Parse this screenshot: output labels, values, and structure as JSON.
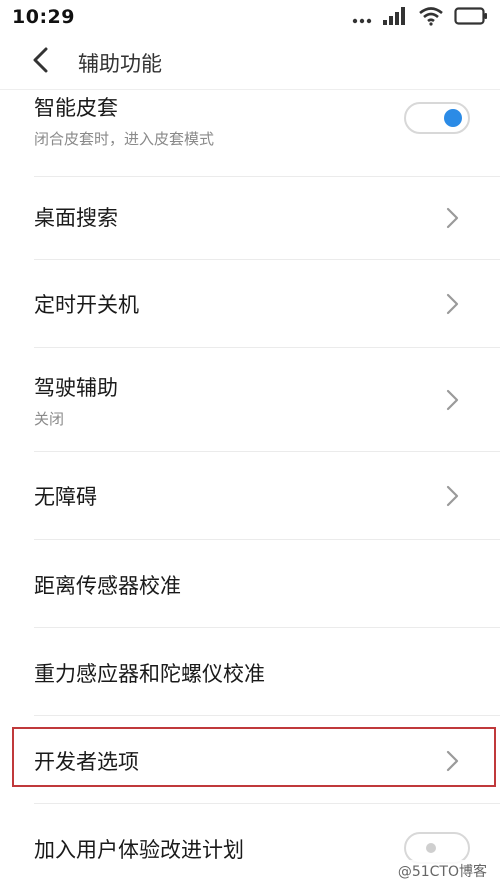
{
  "status_bar": {
    "time": "10:29",
    "icons": [
      "more-dots-icon",
      "signal-icon",
      "wifi-icon",
      "battery-icon"
    ]
  },
  "header": {
    "title": "辅助功能",
    "back_icon": "back-arrow-icon"
  },
  "settings": [
    {
      "id": "smart-cover",
      "title": "智能皮套",
      "subtitle": "闭合皮套时，进入皮套模式",
      "control": "toggle",
      "toggle_on": true
    },
    {
      "id": "desktop-search",
      "title": "桌面搜索",
      "control": "chevron"
    },
    {
      "id": "scheduled-power",
      "title": "定时开关机",
      "control": "chevron"
    },
    {
      "id": "driving-assist",
      "title": "驾驶辅助",
      "subtitle": "关闭",
      "control": "chevron"
    },
    {
      "id": "accessibility",
      "title": "无障碍",
      "control": "chevron"
    },
    {
      "id": "proximity-calibration",
      "title": "距离传感器校准",
      "control": "none"
    },
    {
      "id": "gravity-gyro-calibration",
      "title": "重力感应器和陀螺仪校准",
      "control": "none"
    },
    {
      "id": "developer-options",
      "title": "开发者选项",
      "control": "chevron",
      "highlighted": true
    },
    {
      "id": "ux-improvement",
      "title": "加入用户体验改进计划",
      "control": "toggle",
      "toggle_on": false
    }
  ],
  "colors": {
    "accent": "#2b8be6",
    "highlight_border": "#c0393b",
    "subtitle": "#8a8a8a",
    "divider": "#ebebeb"
  },
  "watermark": "@51CTO博客"
}
